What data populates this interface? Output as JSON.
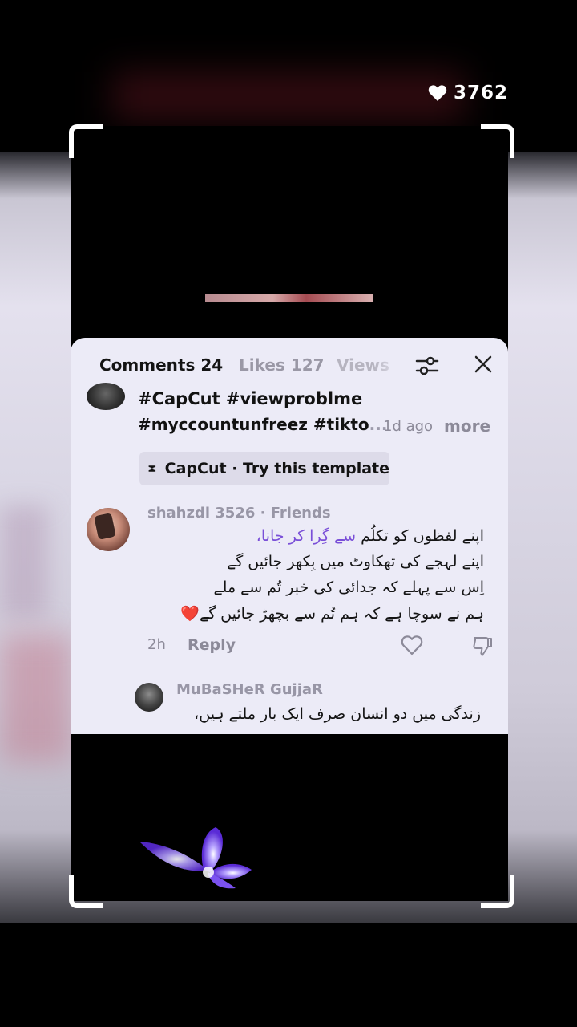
{
  "likes": {
    "count": "3762",
    "icon": "heart-icon"
  },
  "tabs": [
    {
      "label": "Comments 24"
    },
    {
      "label": "Likes 127"
    },
    {
      "label": "Views"
    }
  ],
  "header_icons": {
    "filter": "sliders-icon",
    "close": "close-icon"
  },
  "caption": {
    "line1": "#CapCut #viewproblme",
    "line2_main": "#myccountunfreez #tikto",
    "line2_fade": "...",
    "time": "1d ago",
    "more": "more"
  },
  "template": {
    "label": "CapCut · Try this template",
    "icon": "capcut-icon"
  },
  "comment": {
    "username": "shahzdi 3526 · Friends",
    "line1_start": "اپنے لفظوں کو تکلُم ",
    "line1_accent": "سے گِرا کر جانا،",
    "line2": "اپنے لہجے کی تھکاوٹ میں بِکھر جائیں گے",
    "line3": "اِس سے پہلے کہ جدائی کی خبر تُم سے ملے",
    "line4": "ہم نے سوچا ہے کہ ہم تُم سے بچھڑ جائیں گے",
    "emoji": "❤️",
    "time": "2h",
    "reply_label": "Reply"
  },
  "reply": {
    "username": "MuBaSHeR GujjaR",
    "text": "زندگی میں دو انسان صرف ایک بار ملتے ہیں،"
  },
  "colors": {
    "accent": "#7a4fd8",
    "sheet_bg": "#ecebf7",
    "heart": "#e2253b"
  }
}
